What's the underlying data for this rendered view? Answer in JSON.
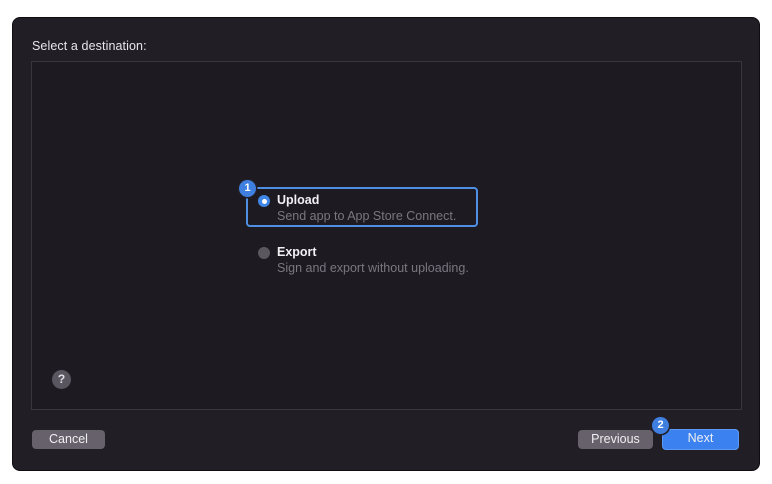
{
  "dialog": {
    "heading": "Select a destination:"
  },
  "options": [
    {
      "title": "Upload",
      "subtitle": "Send app to App Store Connect.",
      "selected": true
    },
    {
      "title": "Export",
      "subtitle": "Sign and export without uploading.",
      "selected": false
    }
  ],
  "annotations": {
    "badge_1": "1",
    "badge_2": "2",
    "accent_color": "#3f86e6"
  },
  "footer": {
    "help_label": "?",
    "cancel_label": "Cancel",
    "previous_label": "Previous",
    "next_label": "Next"
  }
}
